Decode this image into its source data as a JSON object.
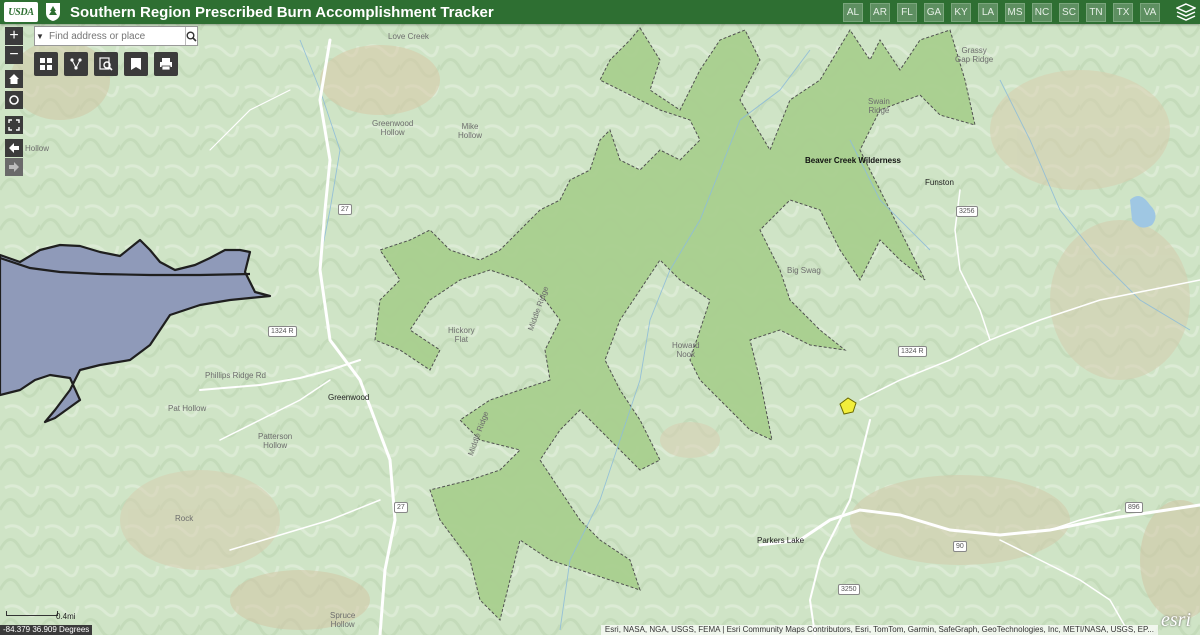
{
  "header": {
    "logo_text": "USDA",
    "title": "Southern Region Prescribed Burn Accomplishment Tracker",
    "states": [
      "AL",
      "AR",
      "FL",
      "GA",
      "KY",
      "LA",
      "MS",
      "NC",
      "SC",
      "TN",
      "TX",
      "VA"
    ]
  },
  "search": {
    "placeholder": "Find address or place"
  },
  "zoom": {
    "in": "+",
    "out": "−"
  },
  "map_labels": {
    "wilderness": "Beaver Creek Wilderness",
    "greenwood": "Greenwood",
    "parkers_lake": "Parkers Lake",
    "funston": "Funston",
    "hickory_flat": "Hickory\nFlat",
    "howard_nook": "Howard\nNook",
    "big_swag": "Big Swag",
    "middle_ridge_1": "Middle Ridge",
    "middle_ridge_2": "Middle Ridge",
    "greenwood_hollow": "Greenwood\nHollow",
    "mike_hollow": "Mike\nHollow",
    "swain_ridge": "Swain\nRidge",
    "grassy_gap": "Grassy\nGap Ridge",
    "phillips_ridge": "Phillips Ridge Rd",
    "pat_hollow": "Pat Hollow",
    "patterson_hollow": "Patterson\nHollow",
    "spruce_hollow": "Spruce\nHollow",
    "rock": "Rock",
    "hollow_left": "Hollow",
    "lake_creek": "Love Creek"
  },
  "shields": {
    "s1": "27",
    "s2": "1324 R",
    "s3": "3256",
    "s4": "27",
    "s5": "896",
    "s6": "90",
    "s7": "3250",
    "s8": "1324 R"
  },
  "scale": {
    "label": "0.4mi"
  },
  "coords": "-84.379 36.909 Degrees",
  "attribution": "Esri, NASA, NGA, USGS, FEMA | Esri Community Maps Contributors, Esri, TomTom, Garmin, SafeGraph, GeoTechnologies, Inc, METI/NASA, USGS, EP...",
  "esri_logo": "esri",
  "colors": {
    "header_bg": "#2e6f32",
    "map_bg": "#cfe4c6",
    "wilderness_fill": "#a9cf8f",
    "burn_polygon_fill": "#8f9ab9",
    "burn_marker": "#f2ee3b"
  }
}
